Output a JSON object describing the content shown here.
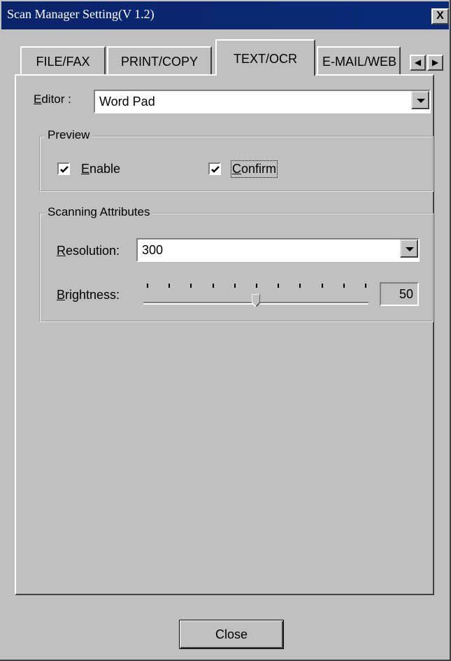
{
  "window": {
    "title": "Scan Manager Setting(V 1.2)",
    "close_glyph": "X"
  },
  "tabs": [
    {
      "label": "FILE/FAX",
      "active": false
    },
    {
      "label": "PRINT/COPY",
      "active": false
    },
    {
      "label": "TEXT/OCR",
      "active": true
    },
    {
      "label": "E-MAIL/WEB",
      "active": false
    }
  ],
  "tab_scroll": {
    "left_icon": "arrow-left-icon",
    "right_icon": "arrow-right-icon"
  },
  "editor": {
    "label_underlined": "E",
    "label_rest": "ditor :",
    "value": "Word Pad"
  },
  "preview": {
    "title": "Preview",
    "enable": {
      "underlined": "E",
      "rest": "nable",
      "checked": true
    },
    "confirm": {
      "underlined": "C",
      "rest": "onfirm",
      "checked": true
    }
  },
  "scanning": {
    "title": "Scanning Attributes",
    "resolution_label_underlined": "R",
    "resolution_label_rest": "esolution:",
    "resolution_value": "300",
    "brightness_label_underlined": "B",
    "brightness_label_rest": "rightness:",
    "brightness_value": "50",
    "brightness_level": 50,
    "brightness_min": 0,
    "brightness_max": 100,
    "tick_count": 11
  },
  "footer": {
    "close_label": "Close"
  },
  "colors": {
    "titlebar": "#0a246a",
    "face": "#c0c0c0"
  }
}
